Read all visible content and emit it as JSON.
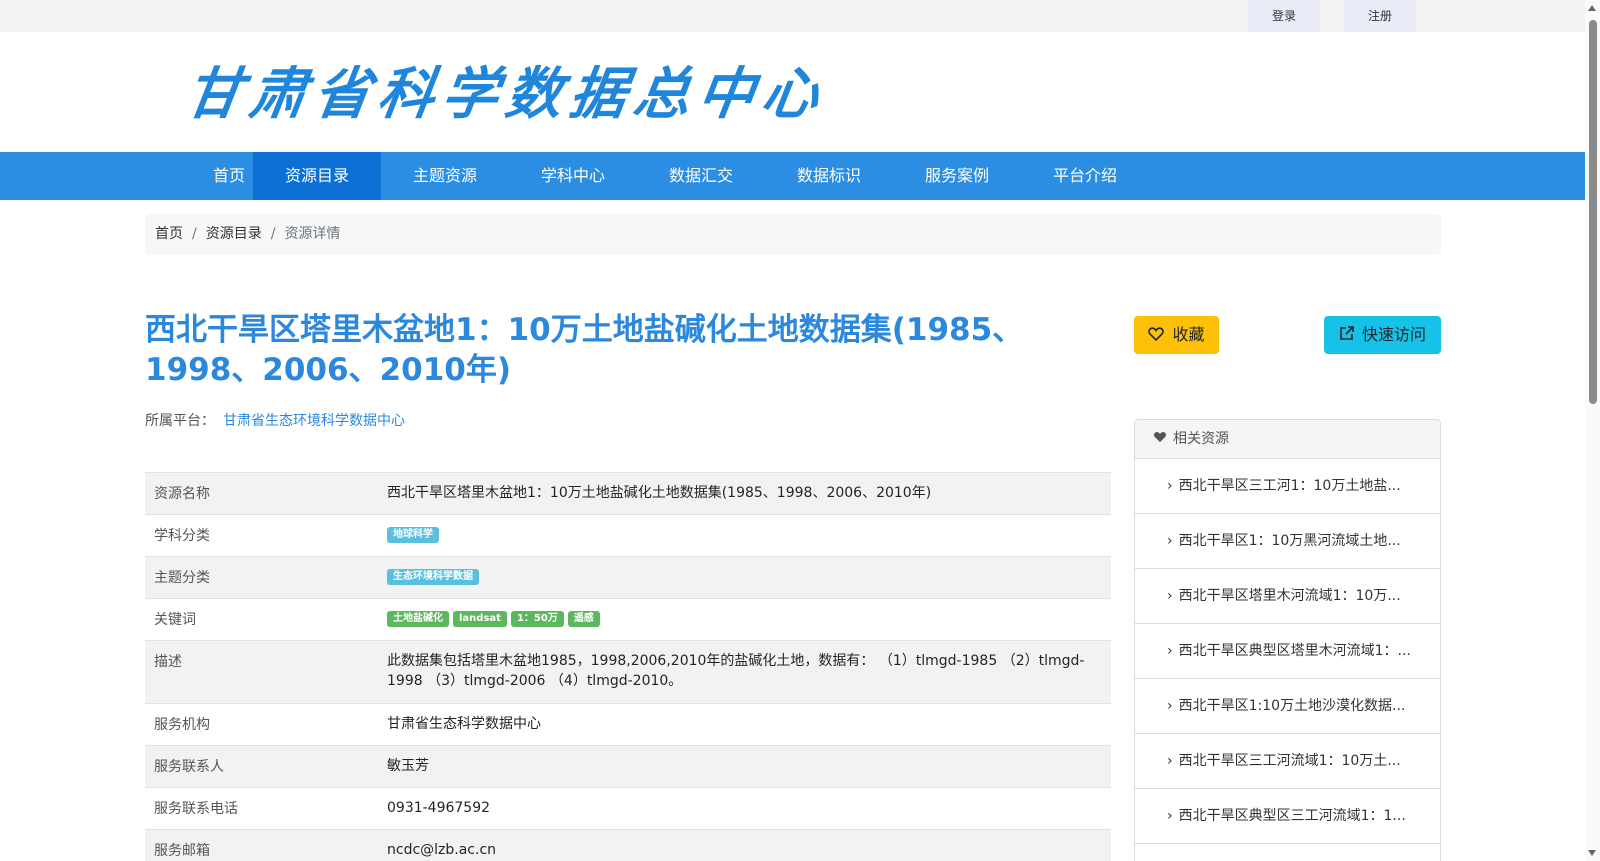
{
  "topbar": {
    "login": "登录",
    "register": "注册"
  },
  "header": {
    "logo_text": "甘肃省科学数据总中心"
  },
  "nav": {
    "items": [
      {
        "label": "首页"
      },
      {
        "label": "资源目录"
      },
      {
        "label": "主题资源"
      },
      {
        "label": "学科中心"
      },
      {
        "label": "数据汇交"
      },
      {
        "label": "数据标识"
      },
      {
        "label": "服务案例"
      },
      {
        "label": "平台介绍"
      }
    ],
    "active_index": 1
  },
  "breadcrumb": {
    "home": "首页",
    "catalog": "资源目录",
    "current": "资源详情"
  },
  "resource": {
    "title": "西北干旱区塔里木盆地1：10万土地盐碱化土地数据集(1985、1998、2006、2010年)",
    "platform_label": "所属平台：",
    "platform_name": "甘肃省生态环境科学数据中心"
  },
  "actions": {
    "favorite": "收藏",
    "quick_access": "快速访问"
  },
  "fields": {
    "name_label": "资源名称",
    "name_value": "西北干旱区塔里木盆地1：10万土地盐碱化土地数据集(1985、1998、2006、2010年)",
    "discipline_label": "学科分类",
    "discipline_tags": [
      "地球科学"
    ],
    "theme_label": "主题分类",
    "theme_tags": [
      "生态环境科学数据"
    ],
    "keywords_label": "关键词",
    "keywords": [
      "土地盐碱化",
      "landsat",
      "1：50万",
      "遥感"
    ],
    "desc_label": "描述",
    "desc_value": "此数据集包括塔里木盆地1985，1998,2006,2010年的盐碱化土地，数据有： （1）tlmgd-1985 （2）tlmgd-1998 （3）tlmgd-2006 （4）tlmgd-2010。",
    "org_label": "服务机构",
    "org_value": "甘肃省生态科学数据中心",
    "contact_label": "服务联系人",
    "contact_value": "敏玉芳",
    "phone_label": "服务联系电话",
    "phone_value": "0931-4967592",
    "email_label": "服务邮箱",
    "email_value": "ncdc@lzb.ac.cn"
  },
  "related": {
    "title": "相关资源",
    "items": [
      "西北干旱区三工河1：10万土地盐...",
      "西北干旱区1：10万黑河流域土地...",
      "西北干旱区塔里木河流域1：10万...",
      "西北干旱区典型区塔里木河流域1：...",
      "西北干旱区1:10万土地沙漠化数据...",
      "西北干旱区三工河流域1：10万土...",
      "西北干旱区典型区三工河流域1：1..."
    ]
  },
  "icons": {
    "favorite": "heart-outline-icon",
    "quick": "external-link-icon",
    "related": "heart-icon",
    "chevron": "chevron-right-icon"
  },
  "colors": {
    "nav_bg": "#2c8ee3",
    "nav_active": "#0c6fd4",
    "title": "#2c88dd",
    "favorite_btn": "#ffc107",
    "quick_btn": "#17c2e8",
    "badge_info": "#5bc0de",
    "badge_success": "#5cb85c"
  }
}
